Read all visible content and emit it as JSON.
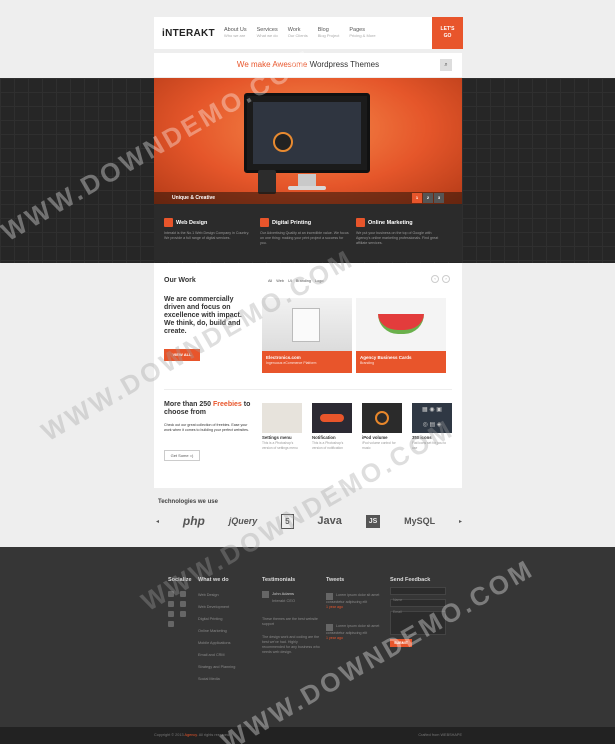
{
  "header": {
    "logo": "iNTERAKT",
    "nav": [
      {
        "title": "About Us",
        "sub": "Who we are"
      },
      {
        "title": "Services",
        "sub": "What we do"
      },
      {
        "title": "Work",
        "sub": "Our Clients"
      },
      {
        "title": "Blog",
        "sub": "Blog Project"
      },
      {
        "title": "Pages",
        "sub": "Pricing & More"
      }
    ],
    "cta_line1": "LET'S",
    "cta_line2": "GO"
  },
  "tagline": {
    "accent": "We make Awesome",
    "rest": "Wordpress Themes"
  },
  "slider": {
    "caption": "Unique & Creative",
    "pages": [
      "1",
      "2",
      "3"
    ]
  },
  "services": [
    {
      "title": "Web Design",
      "text": "Interakt is the No.1 Web Design Company in Country. We provide a full range of digital services."
    },
    {
      "title": "Digital Printing",
      "text": "Our Advertising Quality at an incredible value. We focus on one thing: making your print project a success for you."
    },
    {
      "title": "Online Marketing",
      "text": "We put your business on the top of Google with Agency's online marketing professionals. Find great affiliate services."
    }
  ],
  "work": {
    "title": "Our Work",
    "filters": [
      "All",
      "Web",
      "UI",
      "Branding",
      "Logo"
    ],
    "pitch": "We are commercially driven and focus on excellence with impact. We think, do, build and create.",
    "view_all": "VIEW ALL",
    "items": [
      {
        "name": "Electronics.com",
        "cat": "Ingenuous eCommerce Platform"
      },
      {
        "name": "Agency Business Cards",
        "cat": "Branding"
      }
    ]
  },
  "freebies": {
    "pre": "More than 250",
    "accent": "Freebies",
    "post": "to choose from",
    "text": "Check out our great collection of freebies. Ease your work when it comes to building your perfect websites.",
    "button": "Get Some =)",
    "items": [
      {
        "title": "Settings menu",
        "desc": "This is a Photoshop's version of settings menu"
      },
      {
        "title": "Notification",
        "desc": "This is a Photoshop's version of notification"
      },
      {
        "title": "iPod volume",
        "desc": "iPod volume control for music"
      },
      {
        "title": "350 icons",
        "desc": "Flat icons set for you to use"
      }
    ]
  },
  "tech": {
    "title": "Technologies we use",
    "logos": [
      "php",
      "jQuery",
      "5",
      "Java",
      "JS",
      "MySQL"
    ]
  },
  "footer": {
    "socialize": "Socialize",
    "what": "What we do",
    "what_items": [
      "Web Design",
      "Web Development",
      "Digital Printing",
      "Online Marketing",
      "Mobile Applications",
      "Email and CRM",
      "Strategy and Planning",
      "Social Media"
    ],
    "testimonials": "Testimonials",
    "t_name": "John Adams",
    "t_role": "Interakt CEO",
    "t_quote": "These themes are the best website support",
    "t_quote2": "The design work and coding are the best we've had. Highly recommended for any business who needs web design.",
    "tweets": "Tweets",
    "tweet1": "Lorem ipsum dolor sit amet consectetur adipiscing elit",
    "tweet_time": "1 year ago",
    "feedback": "Send Feedback",
    "fb_name": "Name",
    "fb_email": "Email",
    "fb_send": "SUBMIT"
  },
  "bottom": {
    "copy_pre": "Copyright © 2013",
    "copy_accent": "Agency",
    "copy_post": ". All rights reserved.",
    "right": "Crafted from WEBSHAPE"
  },
  "watermark": "WWW.DOWNDEMO.COM",
  "colors": {
    "accent": "#e8552b",
    "dark": "#262626",
    "footer": "#363636"
  }
}
